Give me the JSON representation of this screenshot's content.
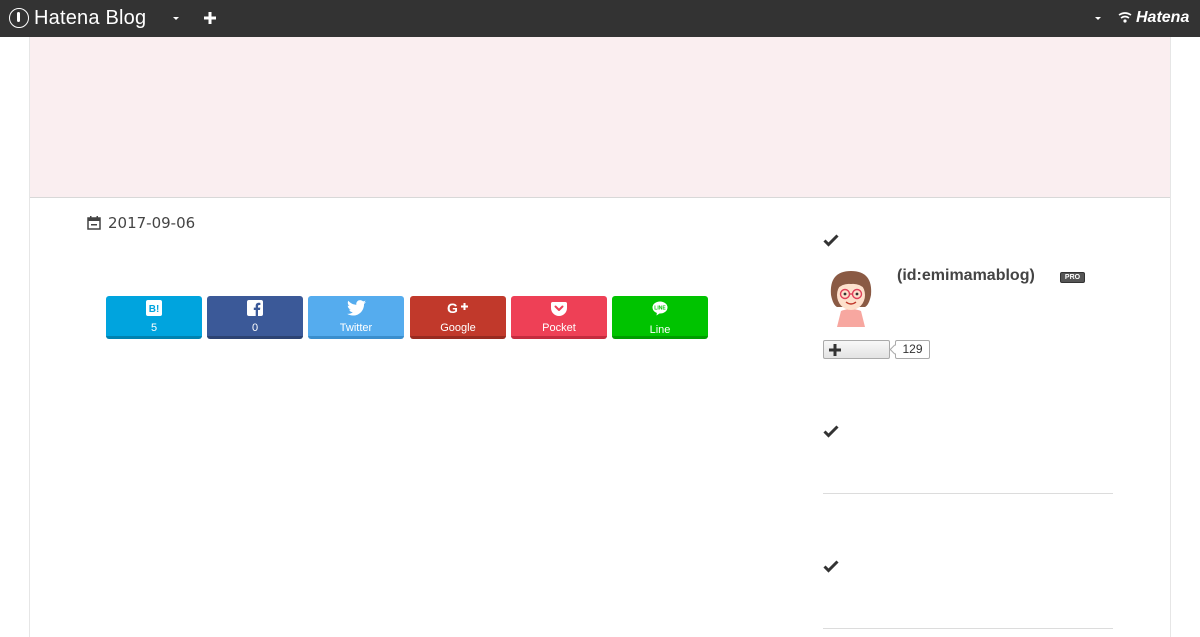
{
  "topbar": {
    "brand": "Hatena Blog",
    "menu_icon": "chevron-down-icon",
    "add_icon": "plus-icon",
    "user_menu_icon": "chevron-down-icon",
    "hatena_logo": "Hatena"
  },
  "colors": {
    "topbar_bg": "#333333",
    "header_band_bg": "#faeef0",
    "hatebu": "#00a4de",
    "facebook": "#3b5998",
    "twitter": "#55acee",
    "google": "#c1392b",
    "pocket": "#ee4056",
    "line": "#00c300"
  },
  "entry": {
    "date": "2017-09-06",
    "date_icon": "calendar-icon"
  },
  "share": {
    "hatebu": {
      "icon": "hatena-bookmark-icon",
      "label": "5"
    },
    "facebook": {
      "icon": "facebook-icon",
      "label": "0"
    },
    "twitter": {
      "icon": "twitter-icon",
      "label": "Twitter"
    },
    "google": {
      "icon": "google-plus-icon",
      "label": "Google"
    },
    "pocket": {
      "icon": "pocket-icon",
      "label": "Pocket"
    },
    "line": {
      "icon": "line-icon",
      "label": "Line"
    }
  },
  "sidebar": {
    "profile": {
      "heading_icon": "check-icon",
      "avatar": "avatar",
      "name": "(id:emimamablog)",
      "badge": "PRO",
      "follow_icon": "plus-icon",
      "follower_count": "129"
    },
    "module2": {
      "heading_icon": "check-icon"
    },
    "module3": {
      "heading_icon": "check-icon"
    }
  }
}
